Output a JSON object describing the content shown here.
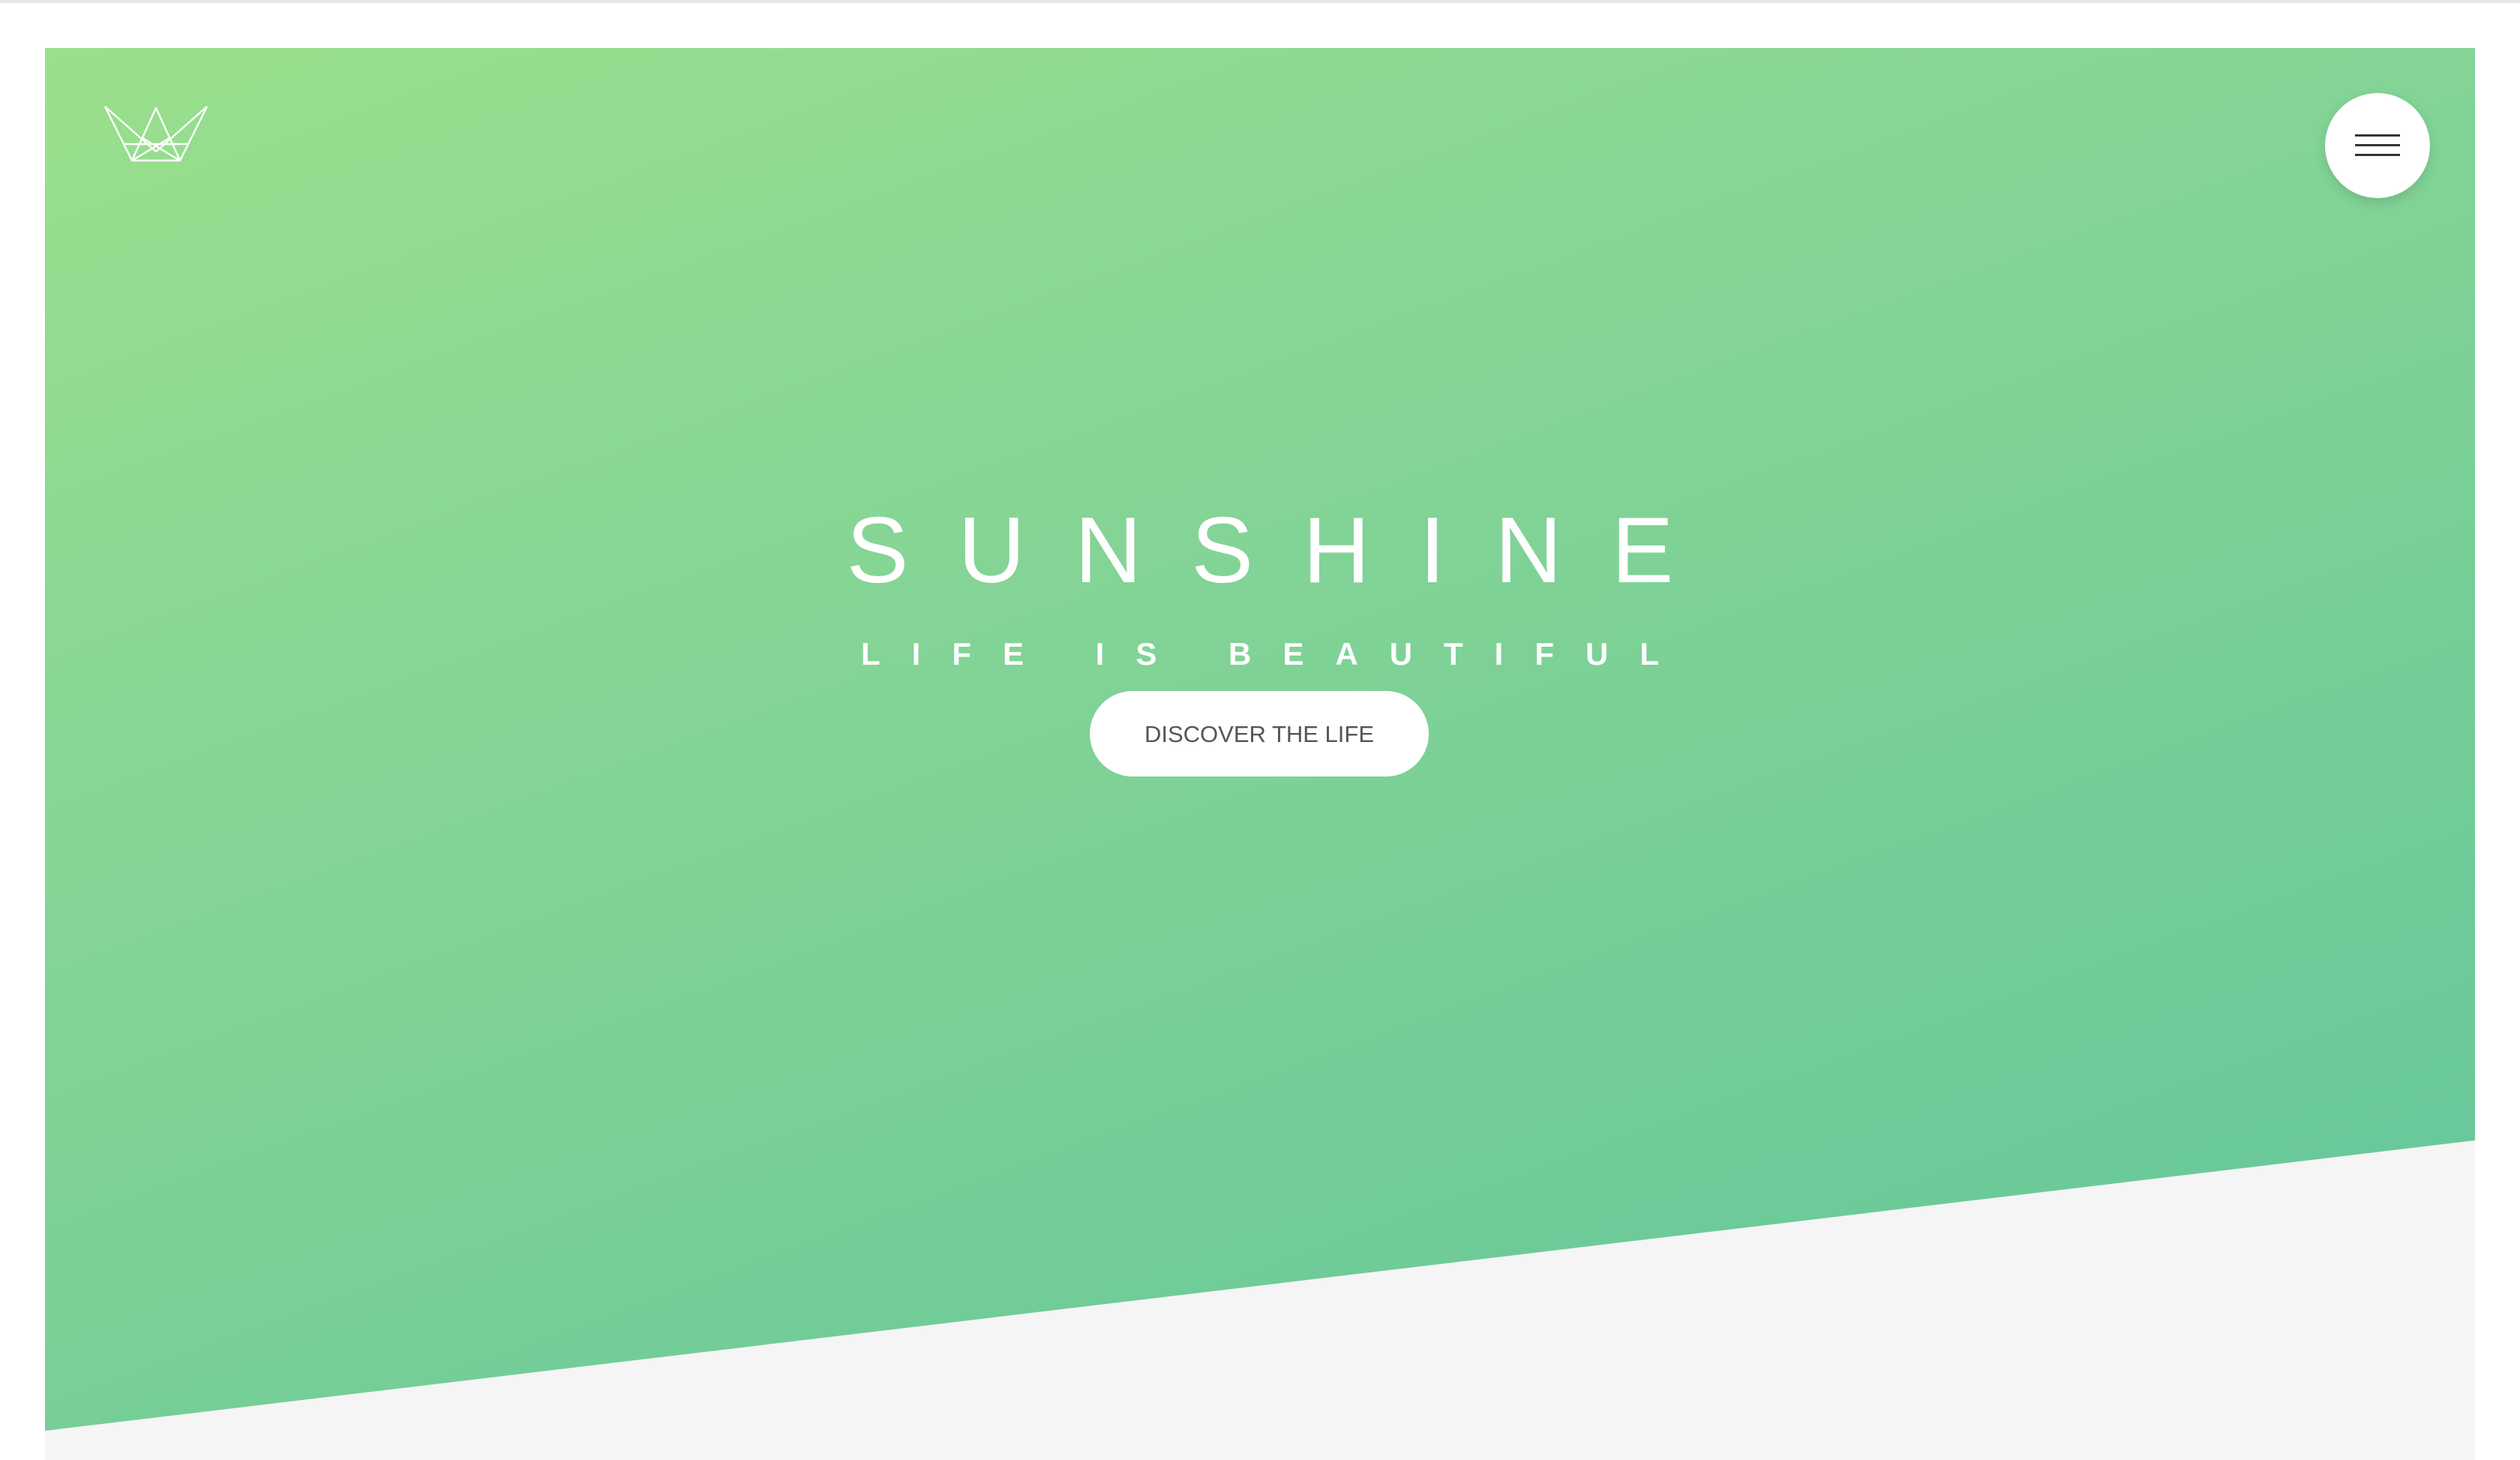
{
  "hero": {
    "title": "SUNSHINE",
    "subtitle": "LIFE IS BEAUTIFUL",
    "cta_label": "DISCOVER THE LIFE"
  },
  "header": {
    "logo_icon": "crown-icon",
    "menu_icon": "hamburger-menu-icon"
  },
  "colors": {
    "gradient_start": "#9adf8c",
    "gradient_end": "#63c69b",
    "page_background": "#f5f5f5",
    "button_background": "#ffffff",
    "button_text": "#555555",
    "menu_lines": "#333333"
  }
}
